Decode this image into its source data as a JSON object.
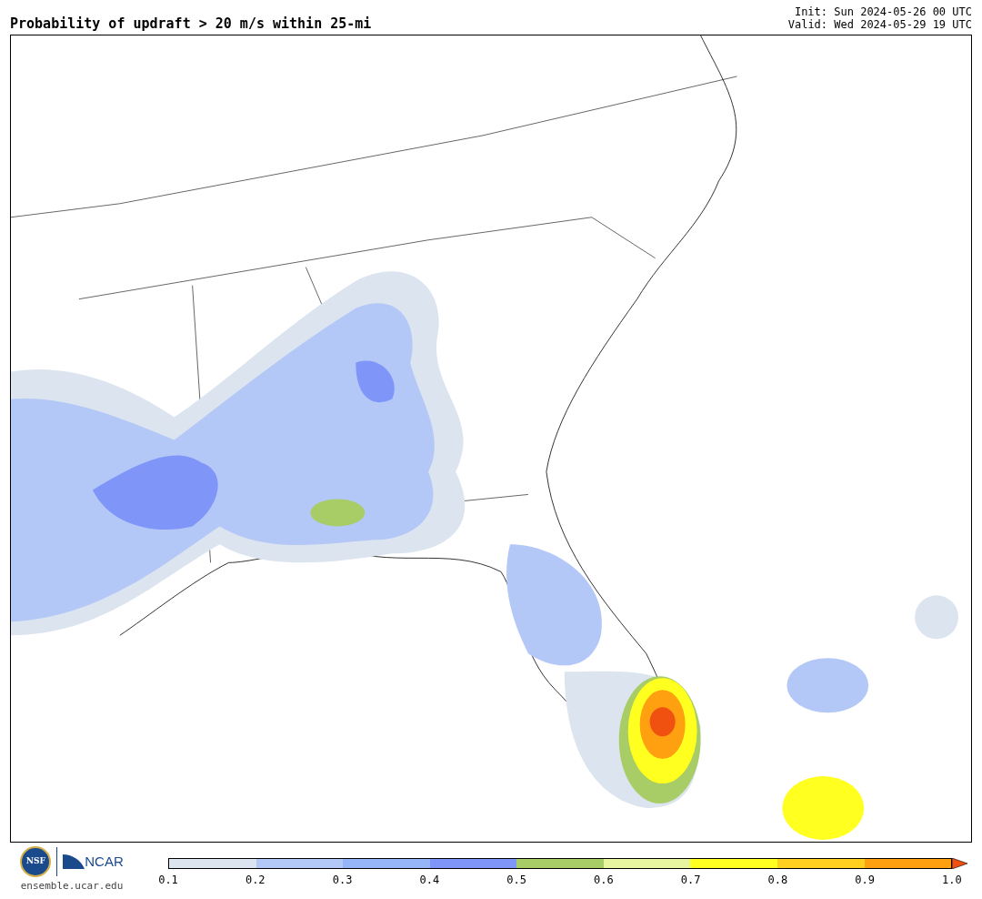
{
  "title": "Probability of updraft > 20 m/s within 25-mi",
  "init": "Init: Sun 2024-05-26 00 UTC",
  "valid": "Valid: Wed 2024-05-29 19 UTC",
  "logos": {
    "nsf": "NSF",
    "ncar": "NCAR",
    "url": "ensemble.ucar.edu"
  },
  "colorbar": {
    "bins": [
      {
        "color": "#dce4ef"
      },
      {
        "color": "#b4c8f8"
      },
      {
        "color": "#96b4f8"
      },
      {
        "color": "#7f96f8"
      },
      {
        "color": "#a8cc66"
      },
      {
        "color": "#e8f5a0"
      },
      {
        "color": "#ffff20"
      },
      {
        "color": "#ffd020"
      },
      {
        "color": "#ffa010"
      }
    ],
    "extend": {
      "color": "#f05010"
    },
    "ticks": [
      "0.1",
      "0.2",
      "0.3",
      "0.4",
      "0.5",
      "0.6",
      "0.7",
      "0.8",
      "0.9",
      "1.0"
    ]
  }
}
